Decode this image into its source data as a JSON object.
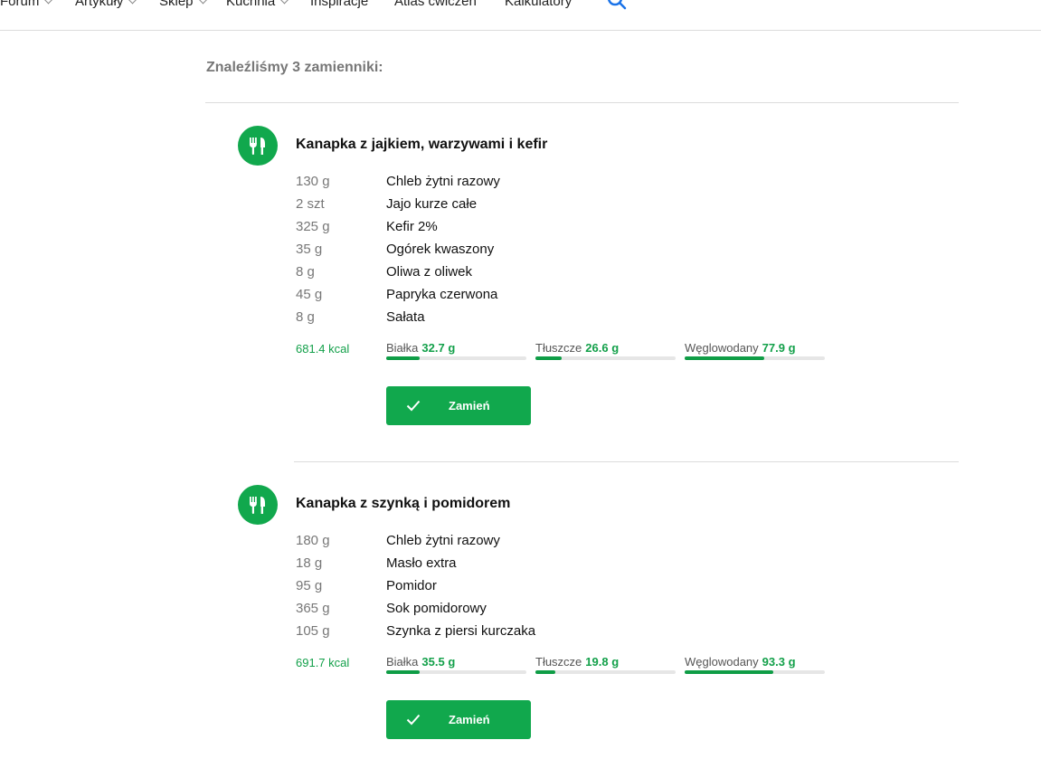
{
  "nav": {
    "items": [
      {
        "label": "Forum",
        "has_dropdown": true
      },
      {
        "label": "Artykuły",
        "has_dropdown": true
      },
      {
        "label": "Sklep",
        "has_dropdown": true
      },
      {
        "label": "Kuchnia",
        "has_dropdown": true
      },
      {
        "label": "Inspiracje",
        "has_dropdown": false
      },
      {
        "label": "Atlas ćwiczeń",
        "has_dropdown": false
      },
      {
        "label": "Kalkulatory",
        "has_dropdown": false
      }
    ],
    "search_icon": "search-icon"
  },
  "results": {
    "heading": "Znaleźliśmy 3 zamienniki:"
  },
  "colors": {
    "accent": "#11a84d",
    "muted_text": "#777777",
    "divider": "#dcdcdc",
    "link_blue": "#1a73e8"
  },
  "meals": [
    {
      "icon": "cutlery-icon",
      "title": "Kanapka z jajkiem, warzywami i kefir",
      "ingredients": [
        {
          "qty": "130 g",
          "name": "Chleb żytni razowy"
        },
        {
          "qty": "2 szt",
          "name": "Jajo kurze całe"
        },
        {
          "qty": "325 g",
          "name": "Kefir 2%"
        },
        {
          "qty": "35 g",
          "name": "Ogórek kwaszony"
        },
        {
          "qty": "8 g",
          "name": "Oliwa z oliwek"
        },
        {
          "qty": "45 g",
          "name": "Papryka czerwona"
        },
        {
          "qty": "8 g",
          "name": "Sałata"
        }
      ],
      "kcal": "681.4 kcal",
      "macros": [
        {
          "label": "Białka",
          "value": "32.7 g",
          "fill": 0.24
        },
        {
          "label": "Tłuszcze",
          "value": "26.6 g",
          "fill": 0.19
        },
        {
          "label": "Węglowodany",
          "value": "77.9 g",
          "fill": 0.57
        }
      ],
      "button_label": "Zamień"
    },
    {
      "icon": "cutlery-icon",
      "title": "Kanapka z szynką i pomidorem",
      "ingredients": [
        {
          "qty": "180 g",
          "name": "Chleb żytni razowy"
        },
        {
          "qty": "18 g",
          "name": "Masło extra"
        },
        {
          "qty": "95 g",
          "name": "Pomidor"
        },
        {
          "qty": "365 g",
          "name": "Sok pomidorowy"
        },
        {
          "qty": "105 g",
          "name": "Szynka z piersi kurczaka"
        }
      ],
      "kcal": "691.7 kcal",
      "macros": [
        {
          "label": "Białka",
          "value": "35.5 g",
          "fill": 0.24
        },
        {
          "label": "Tłuszcze",
          "value": "19.8 g",
          "fill": 0.14
        },
        {
          "label": "Węglowodany",
          "value": "93.3 g",
          "fill": 0.63
        }
      ],
      "button_label": "Zamień"
    }
  ]
}
